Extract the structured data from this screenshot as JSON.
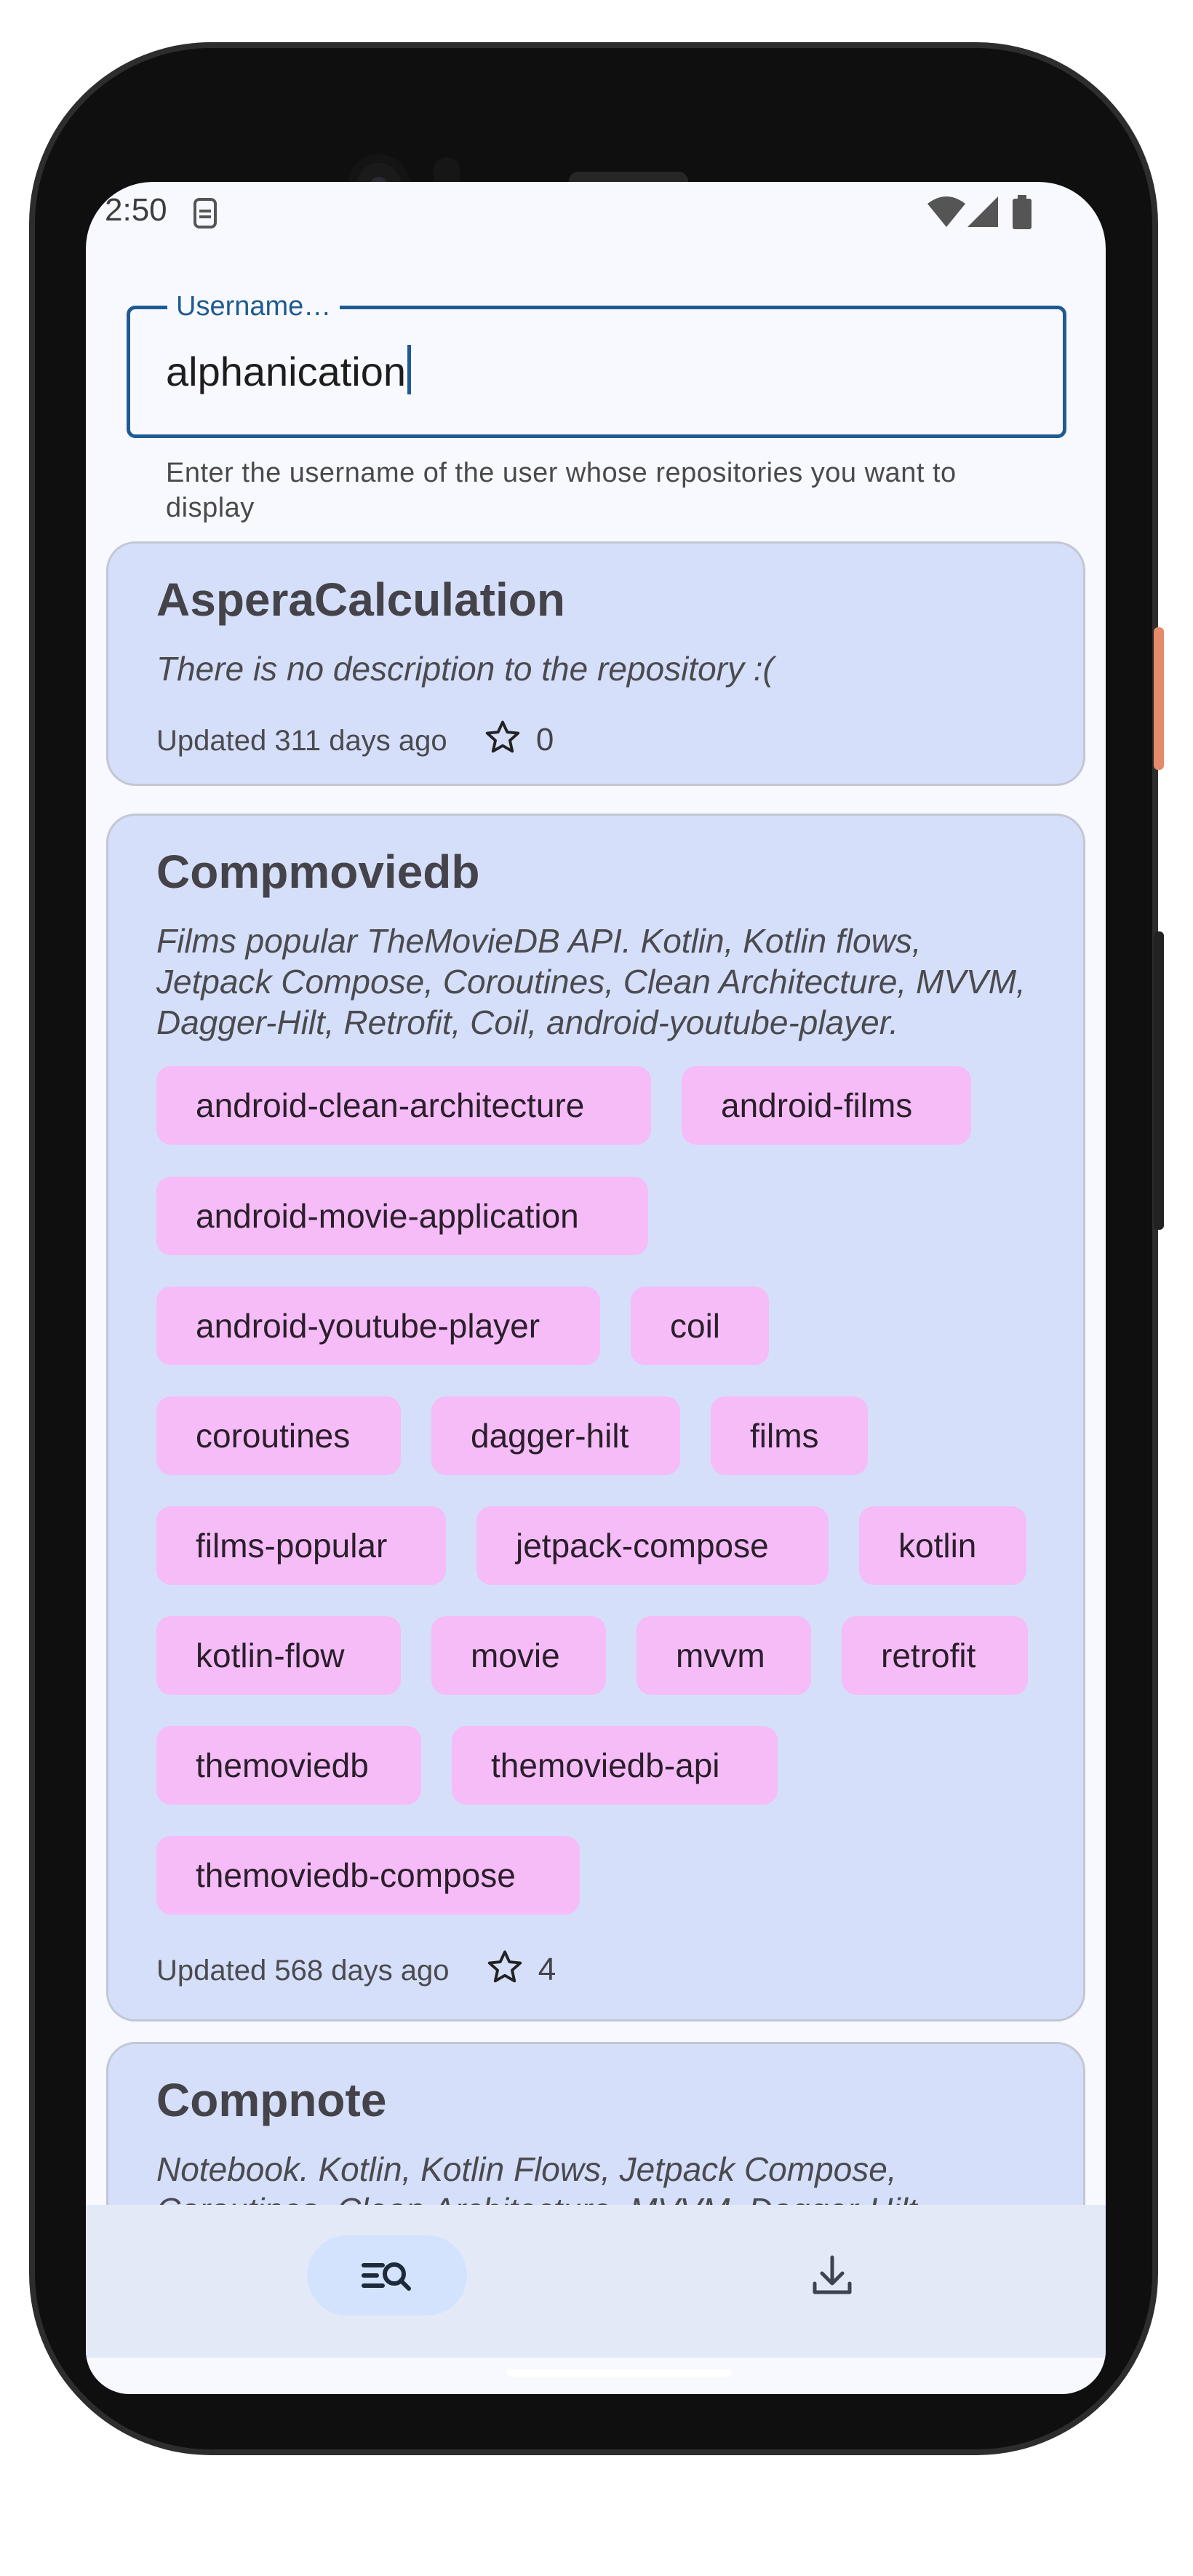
{
  "status_bar": {
    "time": "2:50"
  },
  "search": {
    "label": "Username…",
    "value": "alphanication",
    "helper": "Enter the username of the user whose repositories you want to display"
  },
  "repos": [
    {
      "name": "AsperaCalculation",
      "description": "There is no description to the repository :(",
      "updated": "Updated 311 days ago",
      "stars": "0",
      "topics": []
    },
    {
      "name": "Compmoviedb",
      "description": "Films popular TheMovieDB API. Kotlin, Kotlin flows, Jetpack Compose, Coroutines, Clean Architecture, MVVM, Dagger-Hilt, Retrofit, Coil, android-youtube-player.",
      "updated": "Updated 568 days ago",
      "stars": "4",
      "topics": [
        "android-clean-architecture",
        "android-films",
        "android-movie-application",
        "android-youtube-player",
        "coil",
        "coroutines",
        "dagger-hilt",
        "films",
        "films-popular",
        "jetpack-compose",
        "kotlin",
        "kotlin-flow",
        "movie",
        "mvvm",
        "retrofit",
        "themoviedb",
        "themoviedb-api",
        "themoviedb-compose"
      ]
    },
    {
      "name": "Compnote",
      "description": "Notebook. Kotlin, Kotlin Flows, Jetpack Compose, Coroutines, Clean Architecture, MVVM, Dagger-Hilt",
      "updated": "",
      "stars": "",
      "topics": []
    }
  ],
  "bottom_nav": [
    {
      "icon": "search-list-icon",
      "selected": true
    },
    {
      "icon": "download-icon",
      "selected": false
    }
  ],
  "colors": {
    "accent": "#1f5a92",
    "card": "#d5dffa",
    "chip": "#f5bcf7",
    "nav": "#e3e9f7"
  }
}
